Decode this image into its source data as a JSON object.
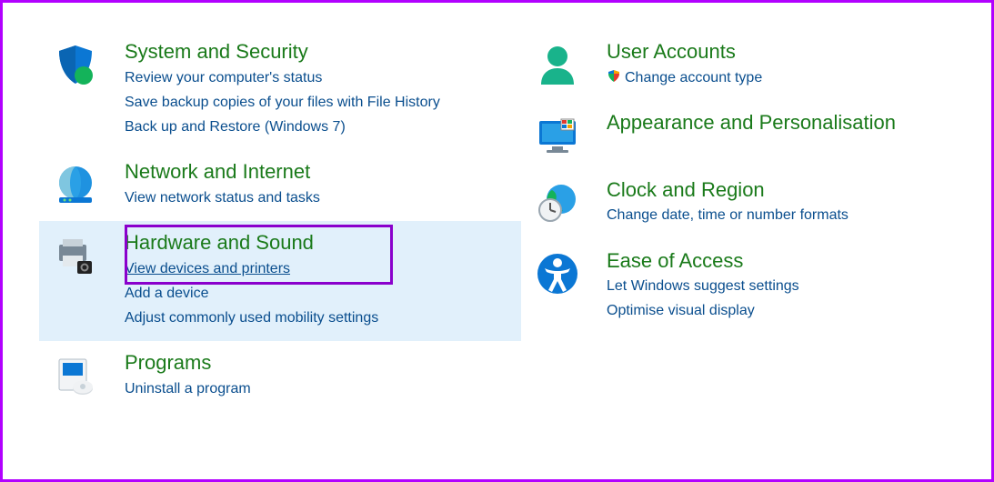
{
  "left": [
    {
      "id": "system-security",
      "title": "System and Security",
      "links": [
        {
          "label": "Review your computer's status",
          "shield": false
        },
        {
          "label": "Save backup copies of your files with File History",
          "shield": false
        },
        {
          "label": "Back up and Restore (Windows 7)",
          "shield": false
        }
      ],
      "highlight": false
    },
    {
      "id": "network-internet",
      "title": "Network and Internet",
      "links": [
        {
          "label": "View network status and tasks",
          "shield": false
        }
      ],
      "highlight": false
    },
    {
      "id": "hardware-sound",
      "title": "Hardware and Sound",
      "links": [
        {
          "label": "View devices and printers",
          "shield": false,
          "underline": true
        },
        {
          "label": "Add a device",
          "shield": false
        },
        {
          "label": "Adjust commonly used mobility settings",
          "shield": false
        }
      ],
      "highlight": true
    },
    {
      "id": "programs",
      "title": "Programs",
      "links": [
        {
          "label": "Uninstall a program",
          "shield": false
        }
      ],
      "highlight": false
    }
  ],
  "right": [
    {
      "id": "user-accounts",
      "title": "User Accounts",
      "links": [
        {
          "label": "Change account type",
          "shield": true
        }
      ]
    },
    {
      "id": "appearance",
      "title": "Appearance and Personalisation",
      "links": []
    },
    {
      "id": "clock-region",
      "title": "Clock and Region",
      "links": [
        {
          "label": "Change date, time or number formats",
          "shield": false
        }
      ]
    },
    {
      "id": "ease-of-access",
      "title": "Ease of Access",
      "links": [
        {
          "label": "Let Windows suggest settings",
          "shield": false
        },
        {
          "label": "Optimise visual display",
          "shield": false
        }
      ]
    }
  ]
}
